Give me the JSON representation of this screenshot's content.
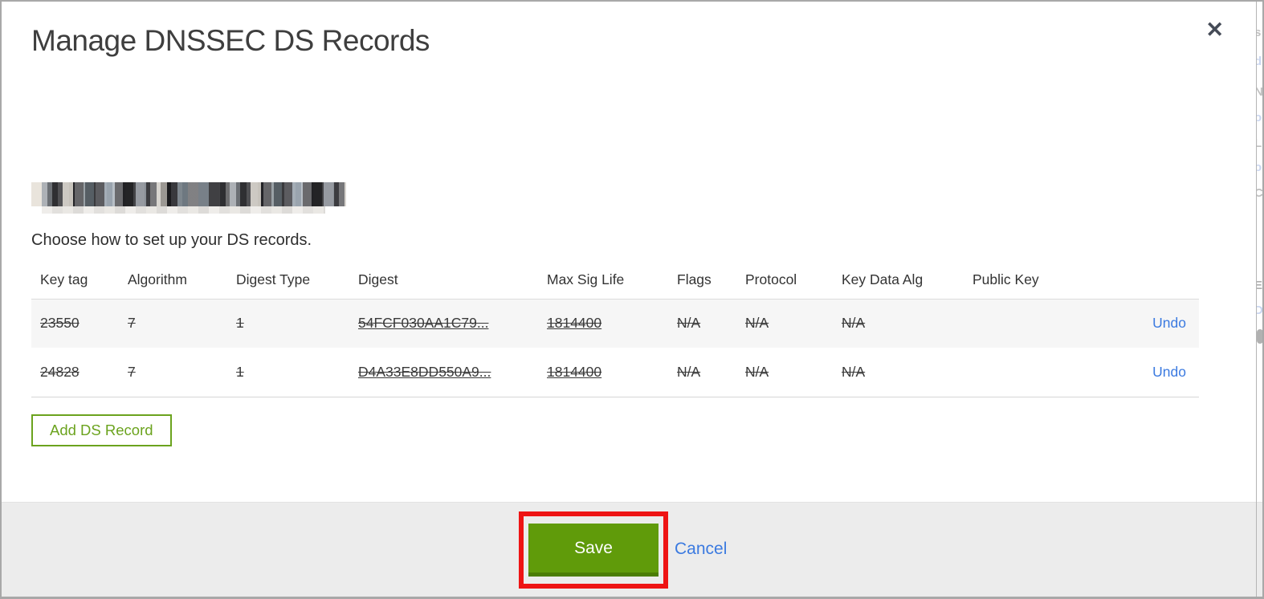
{
  "modal": {
    "title": "Manage DNSSEC DS Records",
    "close_icon": "✕",
    "domain_redacted": true,
    "subtitle": "Choose how to set up your DS records.",
    "table": {
      "headers": [
        "Key tag",
        "Algorithm",
        "Digest Type",
        "Digest",
        "Max Sig Life",
        "Flags",
        "Protocol",
        "Key Data Alg",
        "Public Key"
      ],
      "rows": [
        {
          "key_tag": "23550",
          "algorithm": "7",
          "digest_type": "1",
          "digest": "54FCF030AA1C79...",
          "max_sig_life": "1814400",
          "flags": "N/A",
          "protocol": "N/A",
          "key_data_alg": "N/A",
          "public_key": "",
          "undo_label": "Undo",
          "marked_for_deletion": true
        },
        {
          "key_tag": "24828",
          "algorithm": "7",
          "digest_type": "1",
          "digest": "D4A33E8DD550A9...",
          "max_sig_life": "1814400",
          "flags": "N/A",
          "protocol": "N/A",
          "key_data_alg": "N/A",
          "public_key": "",
          "undo_label": "Undo",
          "marked_for_deletion": true
        }
      ]
    },
    "add_ds_record_label": "Add DS Record",
    "footer": {
      "save_label": "Save",
      "cancel_label": "Cancel"
    }
  },
  "annotation": {
    "highlight_color": "#ee1414",
    "highlighted_element": "save-button"
  },
  "background_edge_fragments": [
    "s",
    "d",
    "N",
    "o",
    "L",
    "o",
    "C",
    "E",
    "D"
  ],
  "colors": {
    "accent_green": "#609b0a",
    "add_button_green": "#6ba31e",
    "link_blue": "#3b7ae0",
    "footer_bg": "#ececec",
    "row_alt_bg": "#f6f6f6"
  }
}
